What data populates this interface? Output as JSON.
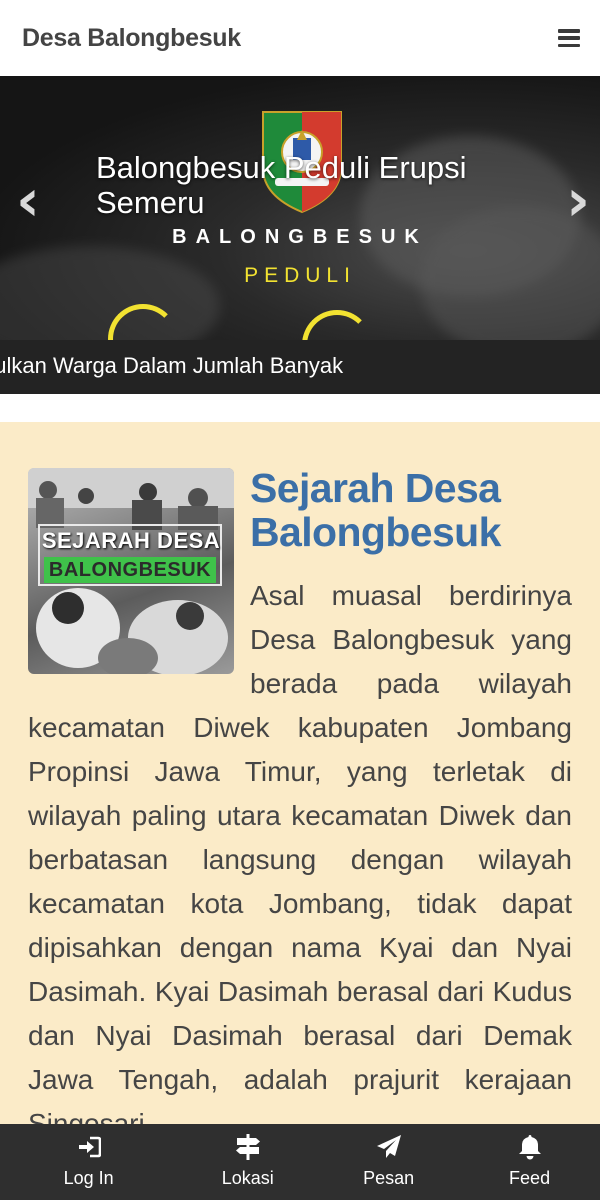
{
  "header": {
    "site_title": "Desa Balongbesuk",
    "menu_icon": "hamburger-menu-icon"
  },
  "slider": {
    "caption": "Balongbesuk Peduli Erupsi Semeru",
    "overlay_word_1": "BALONGBESUK",
    "overlay_word_2": "PEDULI",
    "prev_icon": "chevron-left-icon",
    "next_icon": "chevron-right-icon",
    "ticker_text": "pulkan Warga Dalam Jumlah Banyak",
    "colors": {
      "accent_yellow": "#f2e231",
      "ticker_bg": "#232323"
    }
  },
  "article": {
    "thumbnail_text_1": "SEJARAH DESA",
    "thumbnail_text_2": "BALONGBESUK",
    "title": "Sejarah Desa Balongbesuk",
    "body": "Asal muasal berdirinya Desa Balongbesuk yang berada pada wilayah kecamatan Diwek kabupaten Jombang Propinsi Jawa Timur, yang terletak di wilayah paling utara kecamatan Diwek dan berbatasan langsung dengan wilayah kecamatan kota Jombang, tidak dapat dipisahkan dengan nama Kyai dan Nyai Dasimah. Kyai Dasimah berasal dari Kudus dan Nyai Dasimah berasal dari Demak Jawa Tengah, adalah prajurit kerajaan Singosari",
    "colors": {
      "title": "#3b6fa7",
      "background": "#fbebc8"
    }
  },
  "bottom_nav": {
    "items": [
      {
        "label": "Log In",
        "icon": "sign-in-icon"
      },
      {
        "label": "Lokasi",
        "icon": "signpost-icon"
      },
      {
        "label": "Pesan",
        "icon": "paper-plane-icon"
      },
      {
        "label": "Feed",
        "icon": "bell-icon"
      }
    ]
  }
}
